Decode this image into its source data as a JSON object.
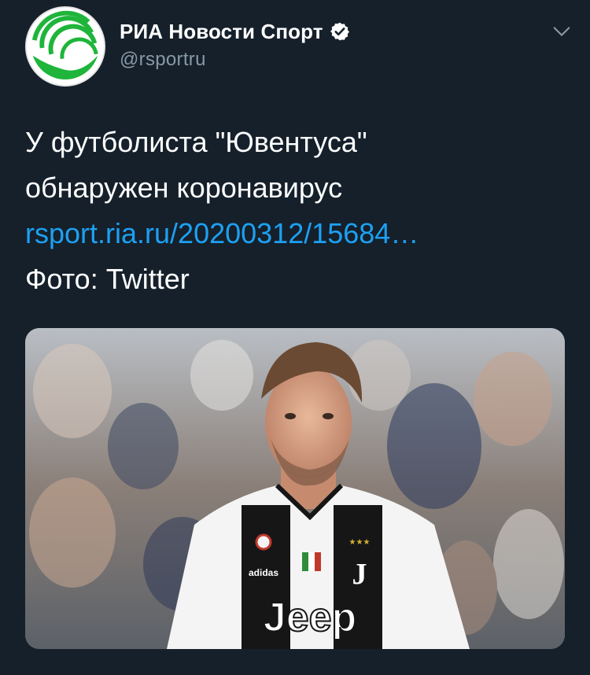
{
  "tweet": {
    "author": {
      "display_name": "РИА Новости Спорт",
      "handle": "@rsportru",
      "verified": true,
      "avatar_icon": "ria-novosti-logo",
      "brand_color": "#1eb53a"
    },
    "menu_icon": "chevron-down-icon",
    "text_lines": [
      "У футболиста \"Ювентуса\"",
      "обнаружен коронавирус"
    ],
    "link_text": "rsport.ria.ru/20200312/15684…",
    "photo_credit": "Фото: Twitter",
    "media": {
      "description_icon": "football-player-photo",
      "jersey_sponsor": "Jeep",
      "kit_brand": "adidas"
    }
  },
  "colors": {
    "background": "#15202b",
    "text": "#ffffff",
    "secondary": "#8899a6",
    "link": "#1da1f2",
    "verified_badge": "#ffffff"
  }
}
